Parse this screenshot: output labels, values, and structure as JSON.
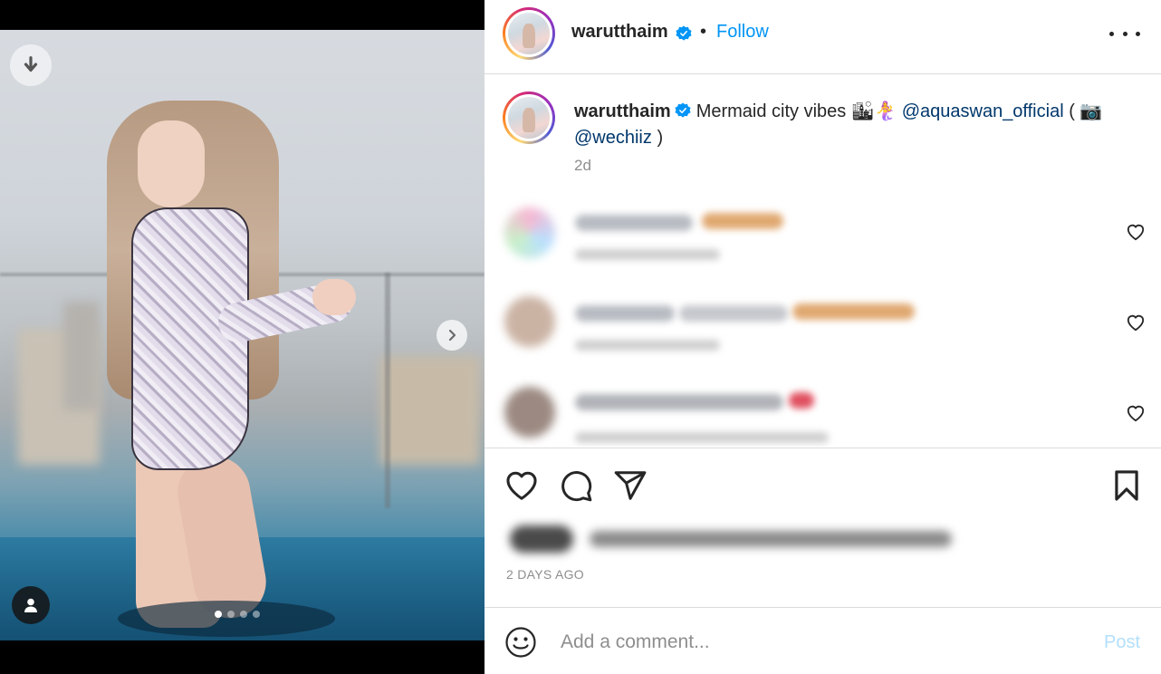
{
  "post": {
    "username": "warutthaim",
    "follow_label": "Follow",
    "separator": "•",
    "caption_text": "Mermaid city vibes 🏙🧜‍♀️",
    "mention_1": "@aquaswan_official",
    "paren_open": " ( 📷",
    "mention_2": "@wechiiz",
    "paren_close": " )",
    "time_ago": "2d",
    "date": "2 DAYS AGO",
    "slides_total": 4,
    "slide_active": 1
  },
  "comment_box": {
    "placeholder": "Add a comment...",
    "post_label": "Post"
  },
  "icons": {
    "download": "download-icon",
    "next": "chevron-right-icon",
    "tag": "user-tag-icon",
    "verified": "verified-badge-icon",
    "more": "more-options-icon",
    "like": "heart-icon",
    "comment": "comment-icon",
    "share": "share-icon",
    "save": "bookmark-icon",
    "emoji": "emoji-icon"
  },
  "colors": {
    "accent": "#0095f6",
    "mention": "#00376b",
    "muted": "#8e8e8e",
    "post_disabled": "#b2dffc"
  }
}
